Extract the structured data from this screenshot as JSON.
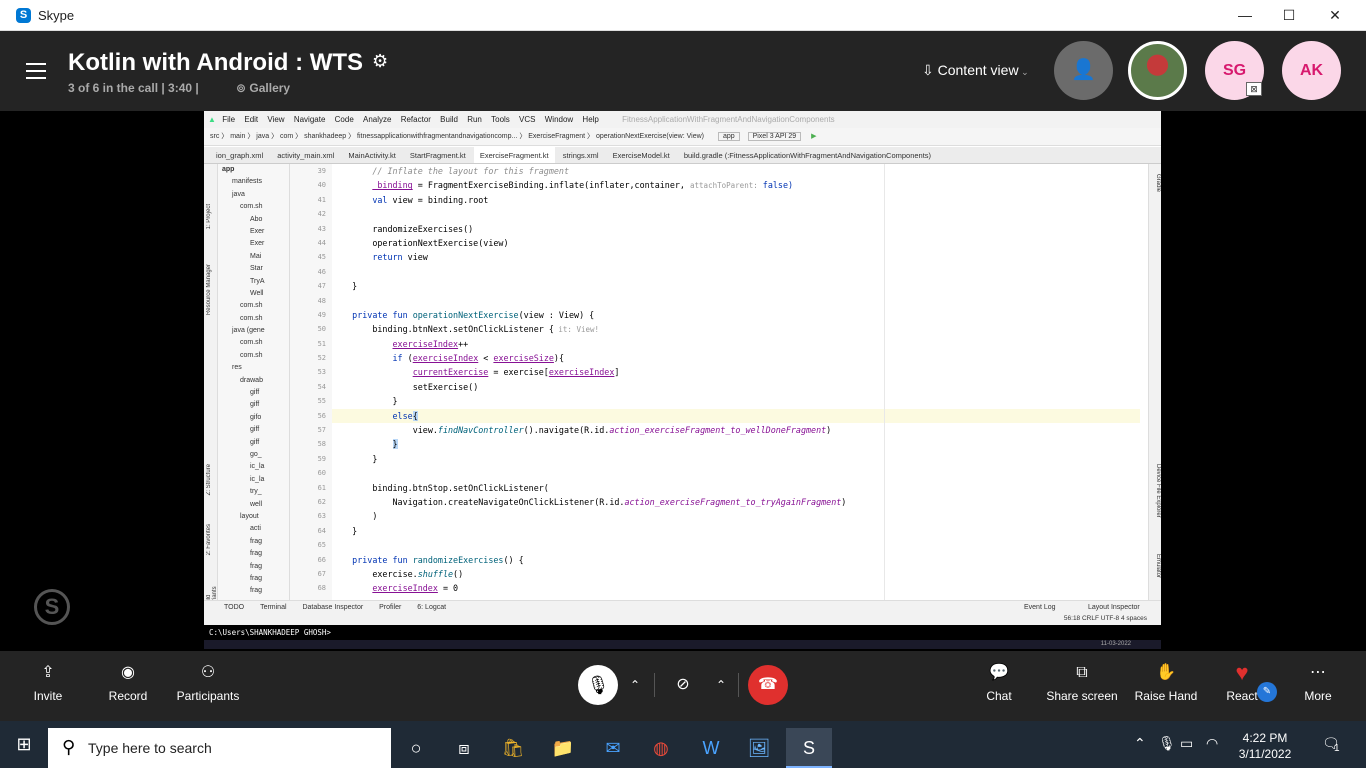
{
  "window": {
    "app_title": "Skype",
    "minimize": "—",
    "maximize": "☐",
    "close": "✕"
  },
  "call_header": {
    "title": "Kotlin with Android  : WTS",
    "subtitle": "3 of 6 in the call | 3:40 |",
    "gallery_label": "Gallery",
    "content_view_label": "Content view",
    "participants": [
      {
        "initials": "",
        "kind": "photo"
      },
      {
        "initials": "SG",
        "kind": "initials"
      },
      {
        "initials": "AK",
        "kind": "initials"
      }
    ]
  },
  "ide": {
    "menu": [
      "File",
      "Edit",
      "View",
      "Navigate",
      "Code",
      "Analyze",
      "Refactor",
      "Build",
      "Run",
      "Tools",
      "VCS",
      "Window",
      "Help"
    ],
    "window_title": "FitnessApplicationWithFragmentAndNavigationComponents",
    "path": "src 〉 main 〉 java 〉 com 〉 shankhadeep 〉 fitnessapplicationwithfragmentandnavigationcomp... 〉 ExerciseFragment 〉 operationNextExercise(view: View)",
    "run_config": "app",
    "device": "Pixel 3 API 29",
    "tabs": [
      "ion_graph.xml",
      "activity_main.xml",
      "MainActivity.kt",
      "StartFragment.kt",
      "ExerciseFragment.kt",
      "strings.xml",
      "ExerciseModel.kt",
      "build.gradle (:FitnessApplicationWithFragmentAndNavigationComponents)"
    ],
    "active_tab": "ExerciseFragment.kt",
    "tree": [
      "app",
      "manifests",
      "java",
      "com.sh",
      "Abo",
      "Exer",
      "Exer",
      "Mai",
      "Star",
      "TryA",
      "Well",
      "com.sh",
      "com.sh",
      "java (gene",
      "com.sh",
      "com.sh",
      "res",
      "drawab",
      "giff",
      "giff",
      "gifo",
      "giff",
      "giff",
      "go_",
      "ic_la",
      "ic_la",
      "try_",
      "well",
      "layout",
      "acti",
      "frag",
      "frag",
      "frag",
      "frag",
      "frag"
    ],
    "line_numbers": [
      "39",
      "40",
      "41",
      "42",
      "43",
      "44",
      "45",
      "46",
      "47",
      "48",
      "49",
      "50",
      "51",
      "52",
      "53",
      "54",
      "55",
      "56",
      "57",
      "58",
      "59",
      "60",
      "61",
      "62",
      "63",
      "64",
      "65",
      "66",
      "67",
      "68"
    ],
    "code": {
      "l39": "// Inflate the layout for this fragment",
      "l40_a": "_binding",
      "l40_b": " = FragmentExerciseBinding.inflate(inflater,container, ",
      "l40_hint": "attachToParent:",
      "l40_c": " false)",
      "l41_a": "val",
      "l41_b": " view = binding.root",
      "l43": "randomizeExercises()",
      "l44": "operationNextExercise(view)",
      "l45_a": "return",
      "l45_b": " view",
      "l47": "}",
      "l49_a": "private fun ",
      "l49_b": "operationNextExercise",
      "l49_c": "(view : View) {",
      "l50_a": "binding.btnNext.setOnClickListener {",
      "l50_hint": " it: View!",
      "l51_a": "exerciseIndex",
      "l51_b": "++",
      "l52_a": "if",
      "l52_b": " (",
      "l52_c": "exerciseIndex",
      "l52_d": " < ",
      "l52_e": "exerciseSize",
      "l52_f": "){",
      "l53_a": "currentExercise",
      "l53_b": " = exercise[",
      "l53_c": "exerciseIndex",
      "l53_d": "]",
      "l54": "setExercise()",
      "l55": "}",
      "l56_a": "else",
      "l56_b": "{",
      "l57_a": "view.",
      "l57_b": "findNavController",
      "l57_c": "().navigate(R.id.",
      "l57_d": "action_exerciseFragment_to_wellDoneFragment",
      "l57_e": ")",
      "l58": "}",
      "l59": "}",
      "l61": "binding.btnStop.setOnClickListener(",
      "l62_a": "Navigation.createNavigateOnClickListener(R.id.",
      "l62_b": "action_exerciseFragment_to_tryAgainFragment",
      "l62_c": ")",
      "l63": ")",
      "l64": "}",
      "l66_a": "private fun ",
      "l66_b": "randomizeExercises",
      "l66_c": "() {",
      "l67_a": "exercise.",
      "l67_b": "shuffle",
      "l67_c": "()",
      "l68_a": "exerciseIndex",
      "l68_b": " = 0"
    },
    "bottom_tools": [
      "TODO",
      "Terminal",
      "Database Inspector",
      "Profiler",
      "6: Logcat"
    ],
    "bottom_right_tools": [
      "Event Log",
      "Layout Inspector"
    ],
    "status": "56:18  CRLF  UTF-8  4 spaces",
    "terminal_prompt": "C:\\Users\\SHANKHADEEP GHOSH>",
    "side_labels": {
      "project": "1: Project",
      "resource": "Resource Manager",
      "structure": "Z: Structure",
      "favorites": "2: Favorites",
      "variants": "Build Variants",
      "gradle": "Gradle",
      "device": "Device File Explorer",
      "emulator": "Emulator"
    },
    "taskstrip_date": "11-03-2022"
  },
  "controls": {
    "invite": "Invite",
    "record": "Record",
    "participants": "Participants",
    "chat": "Chat",
    "share_screen": "Share screen",
    "raise_hand": "Raise Hand",
    "react": "React",
    "more": "More"
  },
  "taskbar": {
    "search_placeholder": "Type here to search",
    "time": "4:22 PM",
    "date": "3/11/2022",
    "notifications": "1"
  }
}
